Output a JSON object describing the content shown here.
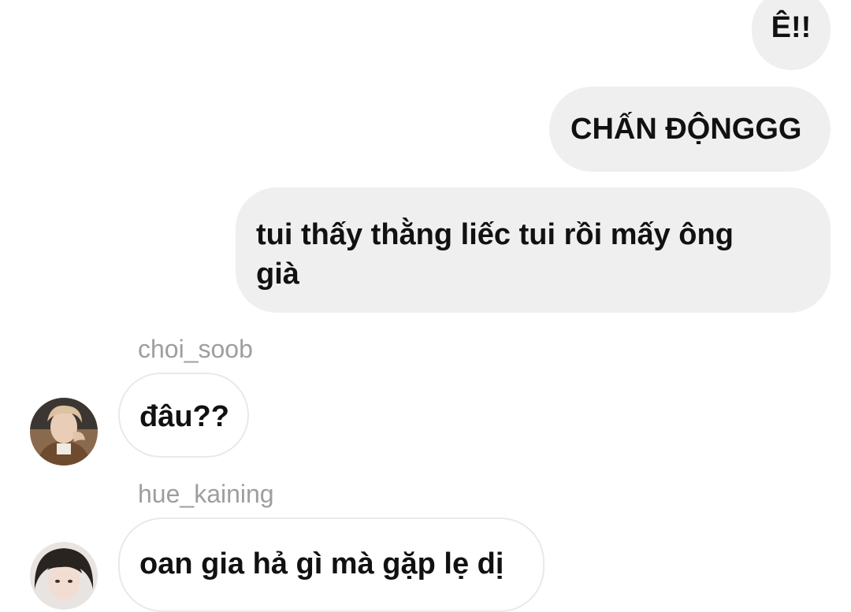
{
  "conversation": {
    "sent_messages": [
      {
        "text": "Ê!!"
      },
      {
        "text": "CHẤN ĐỘNGGG"
      },
      {
        "text": "tui thấy thằng liếc tui rồi mấy ông già"
      }
    ],
    "received_messages": [
      {
        "sender": "choi_soob",
        "text": "đâu??"
      },
      {
        "sender": "hue_kaining",
        "text": "oan gia hả gì mà gặp lẹ dị"
      }
    ]
  },
  "colors": {
    "sent_bubble_bg": "#efefef",
    "received_bubble_border": "#e9e9e9",
    "sender_name": "#9e9e9e",
    "message_text": "#111111"
  }
}
